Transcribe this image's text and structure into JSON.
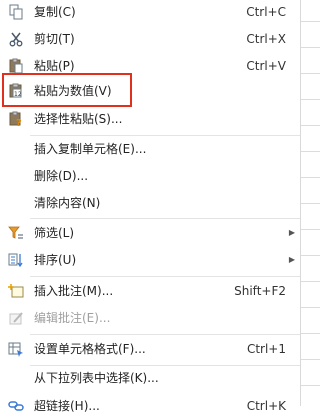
{
  "menu": {
    "copy": {
      "label": "复制(C)",
      "shortcut": "Ctrl+C"
    },
    "cut": {
      "label": "剪切(T)",
      "shortcut": "Ctrl+X"
    },
    "paste": {
      "label": "粘贴(P)",
      "shortcut": "Ctrl+V"
    },
    "paste_values": {
      "label": "粘贴为数值(V)"
    },
    "paste_special": {
      "label": "选择性粘贴(S)..."
    },
    "insert_copied_cells": {
      "label": "插入复制单元格(E)..."
    },
    "delete": {
      "label": "删除(D)..."
    },
    "clear_contents": {
      "label": "清除内容(N)"
    },
    "filter": {
      "label": "筛选(L)"
    },
    "sort": {
      "label": "排序(U)"
    },
    "insert_comment": {
      "label": "插入批注(M)...",
      "shortcut": "Shift+F2"
    },
    "edit_comment": {
      "label": "编辑批注(E)..."
    },
    "format_cells": {
      "label": "设置单元格格式(F)...",
      "shortcut": "Ctrl+1"
    },
    "pick_from_list": {
      "label": "从下拉列表中选择(K)..."
    },
    "hyperlink": {
      "label": "超链接(H)...",
      "shortcut": "Ctrl+K"
    }
  },
  "icons": {
    "copy": "copy-icon",
    "cut": "scissors-icon",
    "paste": "clipboard-icon",
    "paste_values": "paste-values-icon",
    "paste_special": "paste-special-icon",
    "filter": "funnel-icon",
    "sort": "sort-icon",
    "insert_comment": "comment-add-icon",
    "edit_comment": "comment-edit-icon",
    "format_cells": "format-cells-icon",
    "hyperlink": "link-icon"
  },
  "colors": {
    "highlight_border": "#e0301e",
    "disabled_text": "#a0a0a0"
  }
}
